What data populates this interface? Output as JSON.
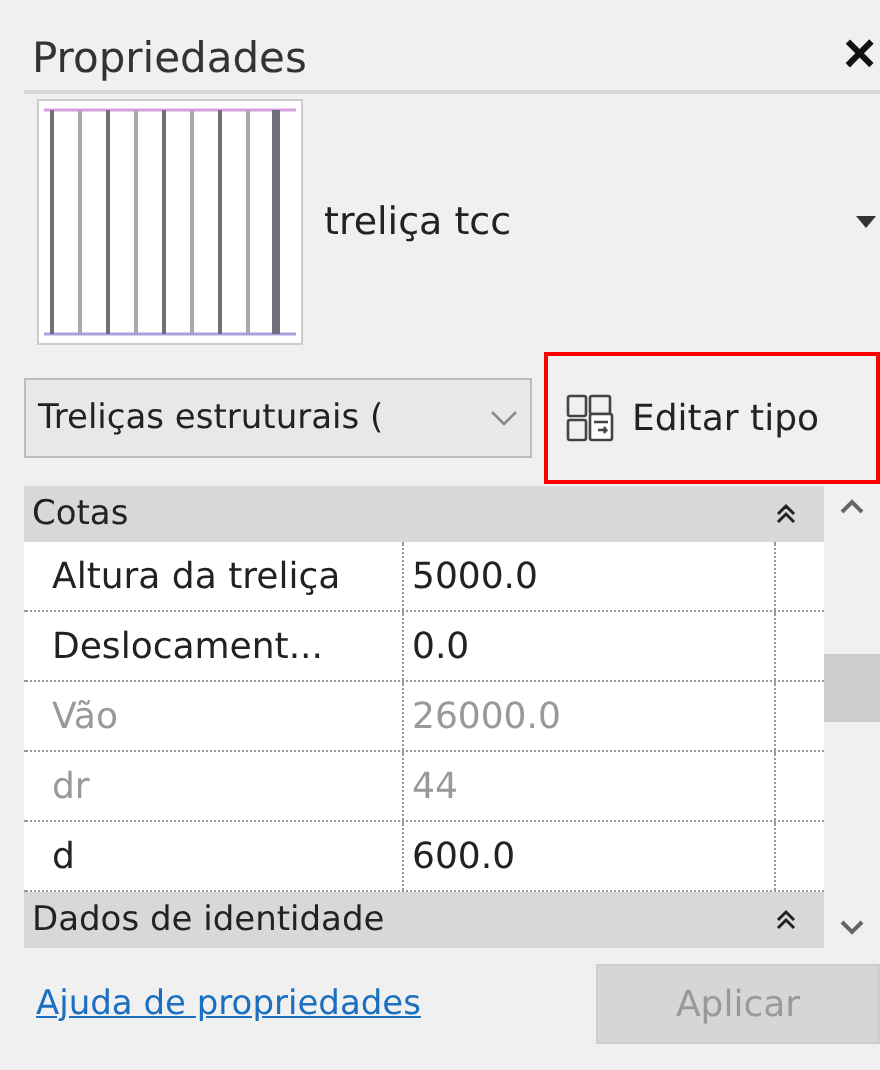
{
  "panel": {
    "title": "Propriedades",
    "close": "×"
  },
  "type_selector": {
    "name": "treliça tcc"
  },
  "filter": {
    "value": "Treliças estruturais ("
  },
  "edit_type": {
    "label": "Editar tipo",
    "highlighted": true
  },
  "groups": [
    {
      "title": "Cotas",
      "expanded": true,
      "rows": [
        {
          "name": "Altura da treliça",
          "value": "5000.0",
          "disabled": false
        },
        {
          "name": "Deslocament...",
          "value": "0.0",
          "disabled": false
        },
        {
          "name": "Vão",
          "value": "26000.0",
          "disabled": true
        },
        {
          "name": "dr",
          "value": "44",
          "disabled": true
        },
        {
          "name": "d",
          "value": "600.0",
          "disabled": false
        }
      ]
    },
    {
      "title": "Dados de identidade",
      "expanded": true
    }
  ],
  "footer": {
    "help_link": "Ajuda de propriedades",
    "apply": {
      "label": "Aplicar",
      "disabled": true
    }
  }
}
